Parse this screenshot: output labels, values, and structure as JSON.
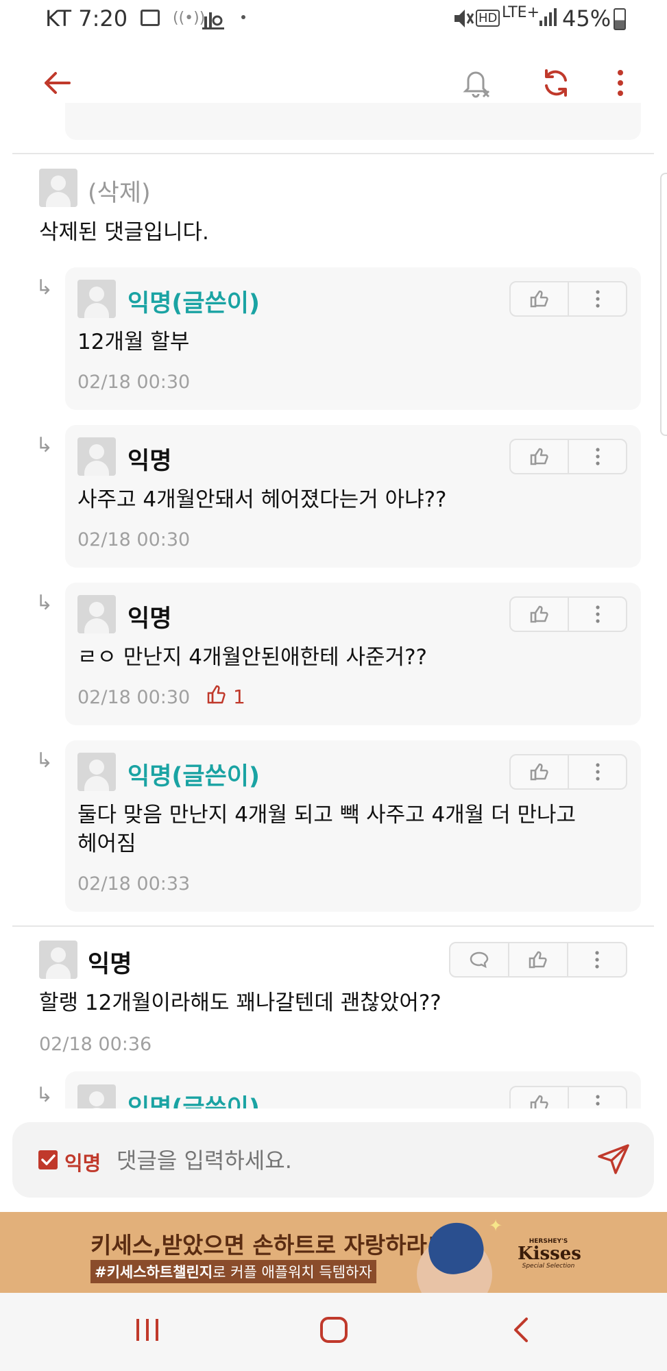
{
  "status_bar": {
    "carrier_time": "KT 7:20",
    "network": "LTE+",
    "battery": "45%"
  },
  "colors": {
    "accent": "#c0392b",
    "author": "#1aa3a3",
    "ad_bg": "#e2b07a"
  },
  "toolbar": {
    "back_icon": "arrow-left-icon",
    "notify_icon": "bell-off-icon",
    "refresh_icon": "refresh-icon",
    "more_icon": "more-vertical-icon"
  },
  "comments": [
    {
      "name": "(삭제)",
      "text": "삭제된 댓글입니다.",
      "replies": [
        {
          "name": "익명(글쓴이)",
          "text": "12개월 할부",
          "time": "02/18 00:30"
        },
        {
          "name": "익명",
          "text": "사주고 4개월안돼서 헤어졌다는거 아냐??",
          "time": "02/18 00:30"
        },
        {
          "name": "익명",
          "text": "ㄹㅇ 만난지 4개월안된애한테 사준거??",
          "time": "02/18 00:30",
          "likes": "1"
        },
        {
          "name": "익명(글쓴이)",
          "text_line1": "둘다 맞음 만난지 4개월 되고 빽 사주고 4개월 더 만나고",
          "text_line2": "헤어짐",
          "time": "02/18 00:33"
        }
      ]
    },
    {
      "name": "익명",
      "text": "할랭 12개월이라해도 꽤나갈텐데 괜찮았어??",
      "time": "02/18 00:36",
      "replies": [
        {
          "name": "익명(글쓴이)"
        }
      ]
    }
  ],
  "input": {
    "anon_label": "익명",
    "placeholder": "댓글을 입력하세요."
  },
  "ad": {
    "headline": "키세스,받았으면 손하트로 자랑하라!",
    "hashtag": "#키세스하트챌린지",
    "subline": "로 커플 애플워치 득템하자",
    "brand_top": "HERSHEY'S",
    "brand": "Kisses",
    "brand_sub": "Special Selection"
  }
}
